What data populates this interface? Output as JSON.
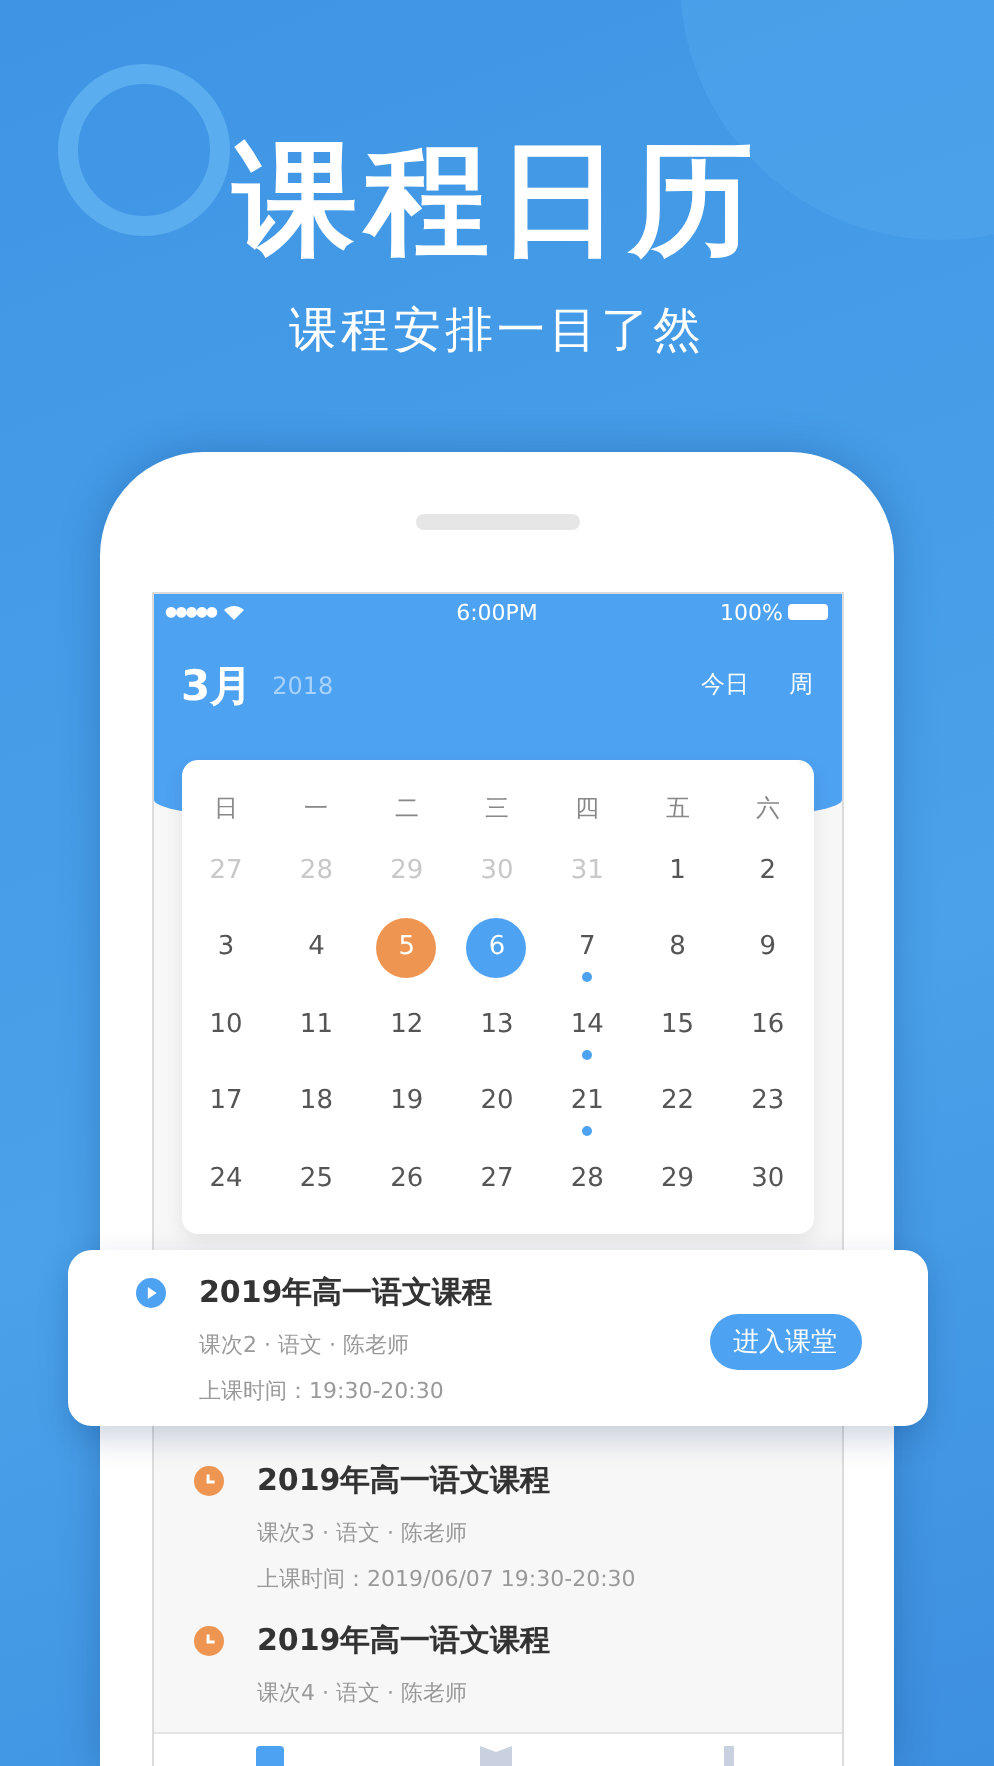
{
  "headline": "课程日历",
  "tagline": "课程安排一目了然",
  "status_bar": {
    "carrier_dots": "●●●●●",
    "time": "6:00PM",
    "battery": "100%"
  },
  "header": {
    "month": "3月",
    "year": "2018",
    "actions": [
      "今日",
      "周"
    ]
  },
  "calendar": {
    "weekdays": [
      "日",
      "一",
      "二",
      "三",
      "四",
      "五",
      "六"
    ],
    "days": [
      {
        "label": "27",
        "muted": true,
        "event": false,
        "today": false,
        "selected": false
      },
      {
        "label": "28",
        "muted": true,
        "event": false,
        "today": false,
        "selected": false
      },
      {
        "label": "29",
        "muted": true,
        "event": false,
        "today": false,
        "selected": false
      },
      {
        "label": "30",
        "muted": true,
        "event": false,
        "today": false,
        "selected": false
      },
      {
        "label": "31",
        "muted": true,
        "event": false,
        "today": false,
        "selected": false
      },
      {
        "label": "1",
        "muted": false,
        "event": false,
        "today": false,
        "selected": false
      },
      {
        "label": "2",
        "muted": false,
        "event": false,
        "today": false,
        "selected": false
      },
      {
        "label": "3",
        "muted": false,
        "event": false,
        "today": false,
        "selected": false
      },
      {
        "label": "4",
        "muted": false,
        "event": false,
        "today": false,
        "selected": false
      },
      {
        "label": "5",
        "muted": false,
        "event": false,
        "today": true,
        "selected": false
      },
      {
        "label": "6",
        "muted": false,
        "event": false,
        "today": false,
        "selected": true
      },
      {
        "label": "7",
        "muted": false,
        "event": true,
        "today": false,
        "selected": false
      },
      {
        "label": "8",
        "muted": false,
        "event": false,
        "today": false,
        "selected": false
      },
      {
        "label": "9",
        "muted": false,
        "event": false,
        "today": false,
        "selected": false
      },
      {
        "label": "10",
        "muted": false,
        "event": false,
        "today": false,
        "selected": false
      },
      {
        "label": "11",
        "muted": false,
        "event": false,
        "today": false,
        "selected": false
      },
      {
        "label": "12",
        "muted": false,
        "event": false,
        "today": false,
        "selected": false
      },
      {
        "label": "13",
        "muted": false,
        "event": false,
        "today": false,
        "selected": false
      },
      {
        "label": "14",
        "muted": false,
        "event": true,
        "today": false,
        "selected": false
      },
      {
        "label": "15",
        "muted": false,
        "event": false,
        "today": false,
        "selected": false
      },
      {
        "label": "16",
        "muted": false,
        "event": false,
        "today": false,
        "selected": false
      },
      {
        "label": "17",
        "muted": false,
        "event": false,
        "today": false,
        "selected": false
      },
      {
        "label": "18",
        "muted": false,
        "event": false,
        "today": false,
        "selected": false
      },
      {
        "label": "19",
        "muted": false,
        "event": false,
        "today": false,
        "selected": false
      },
      {
        "label": "20",
        "muted": false,
        "event": false,
        "today": false,
        "selected": false
      },
      {
        "label": "21",
        "muted": false,
        "event": true,
        "today": false,
        "selected": false
      },
      {
        "label": "22",
        "muted": false,
        "event": false,
        "today": false,
        "selected": false
      },
      {
        "label": "23",
        "muted": false,
        "event": false,
        "today": false,
        "selected": false
      },
      {
        "label": "24",
        "muted": false,
        "event": false,
        "today": false,
        "selected": false
      },
      {
        "label": "25",
        "muted": false,
        "event": false,
        "today": false,
        "selected": false
      },
      {
        "label": "26",
        "muted": false,
        "event": false,
        "today": false,
        "selected": false
      },
      {
        "label": "27",
        "muted": false,
        "event": false,
        "today": false,
        "selected": false
      },
      {
        "label": "28",
        "muted": false,
        "event": false,
        "today": false,
        "selected": false
      },
      {
        "label": "29",
        "muted": false,
        "event": false,
        "today": false,
        "selected": false
      },
      {
        "label": "30",
        "muted": false,
        "event": false,
        "today": false,
        "selected": false
      }
    ]
  },
  "courses": [
    {
      "kind": "live",
      "title": "2019年高一语文课程",
      "meta": "课次2 · 语文 · 陈老师",
      "time": "上课时间：19:30-20:30",
      "button": "进入课堂"
    },
    {
      "kind": "upcoming",
      "title": "2019年高一语文课程",
      "meta": "课次3 · 语文 · 陈老师",
      "time": "上课时间：2019/06/07 19:30-20:30"
    },
    {
      "kind": "upcoming",
      "title": "2019年高一语文课程",
      "meta": "课次4 · 语文 · 陈老师"
    }
  ],
  "tab_bar": [
    {
      "selected": true
    },
    {
      "selected": false
    },
    {
      "selected": false
    }
  ]
}
